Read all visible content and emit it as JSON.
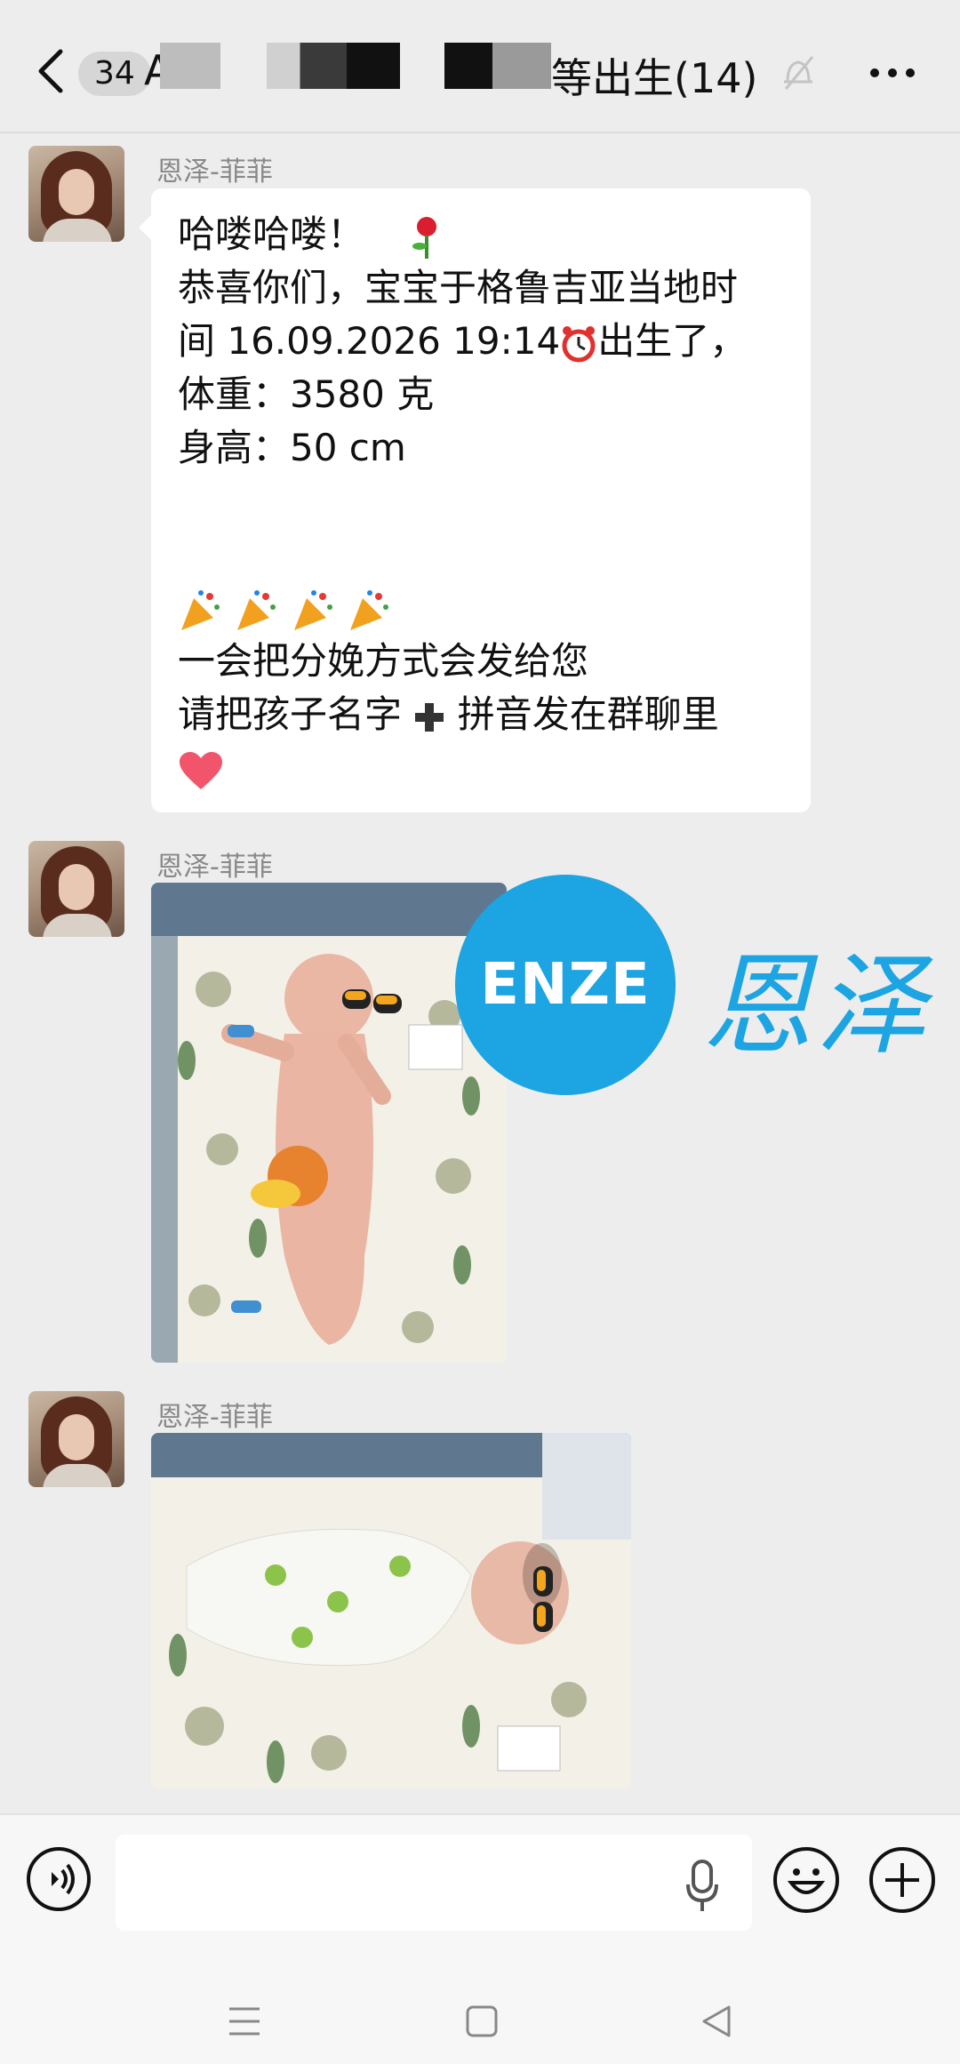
{
  "header": {
    "badge": "34",
    "title_prefix": "A",
    "title": "等出生(14)",
    "icons": [
      "back-arrow-icon",
      "mute-bell-icon",
      "more-icon"
    ]
  },
  "messages": [
    {
      "sender": "恩泽-菲菲",
      "type": "text",
      "lines": [
        "哈喽哈喽！",
        "恭喜你们，宝宝于格鲁吉亚当地时",
        "间 16.09.2026 19:14",
        "出生了，",
        "体重：3580 克",
        "身高：50 cm",
        "一会把分娩方式会发给您",
        "请把孩子名字",
        "拼音发在群聊里"
      ],
      "emojis": [
        "rose-icon",
        "alarm-clock-icon",
        "party-popper-icon",
        "plus-icon",
        "heart-icon"
      ]
    },
    {
      "sender": "恩泽-菲菲",
      "type": "image",
      "content": "newborn-baby-photo-portrait"
    },
    {
      "sender": "恩泽-菲菲",
      "type": "image",
      "content": "newborn-baby-photo-landscape"
    }
  ],
  "watermark": {
    "logo_text": "ENZE",
    "logo_cn": "恩泽",
    "color": "#1ca4e3"
  },
  "colors": {
    "background": "#ededed",
    "bubble": "#ffffff",
    "accent": "#1ca4e3"
  },
  "input_bar": {
    "placeholder": "",
    "icons": [
      "voice-icon",
      "microphone-icon",
      "emoji-icon",
      "plus-icon"
    ]
  },
  "navbar": {
    "icons": [
      "menu-icon",
      "home-square-icon",
      "back-triangle-icon"
    ]
  }
}
